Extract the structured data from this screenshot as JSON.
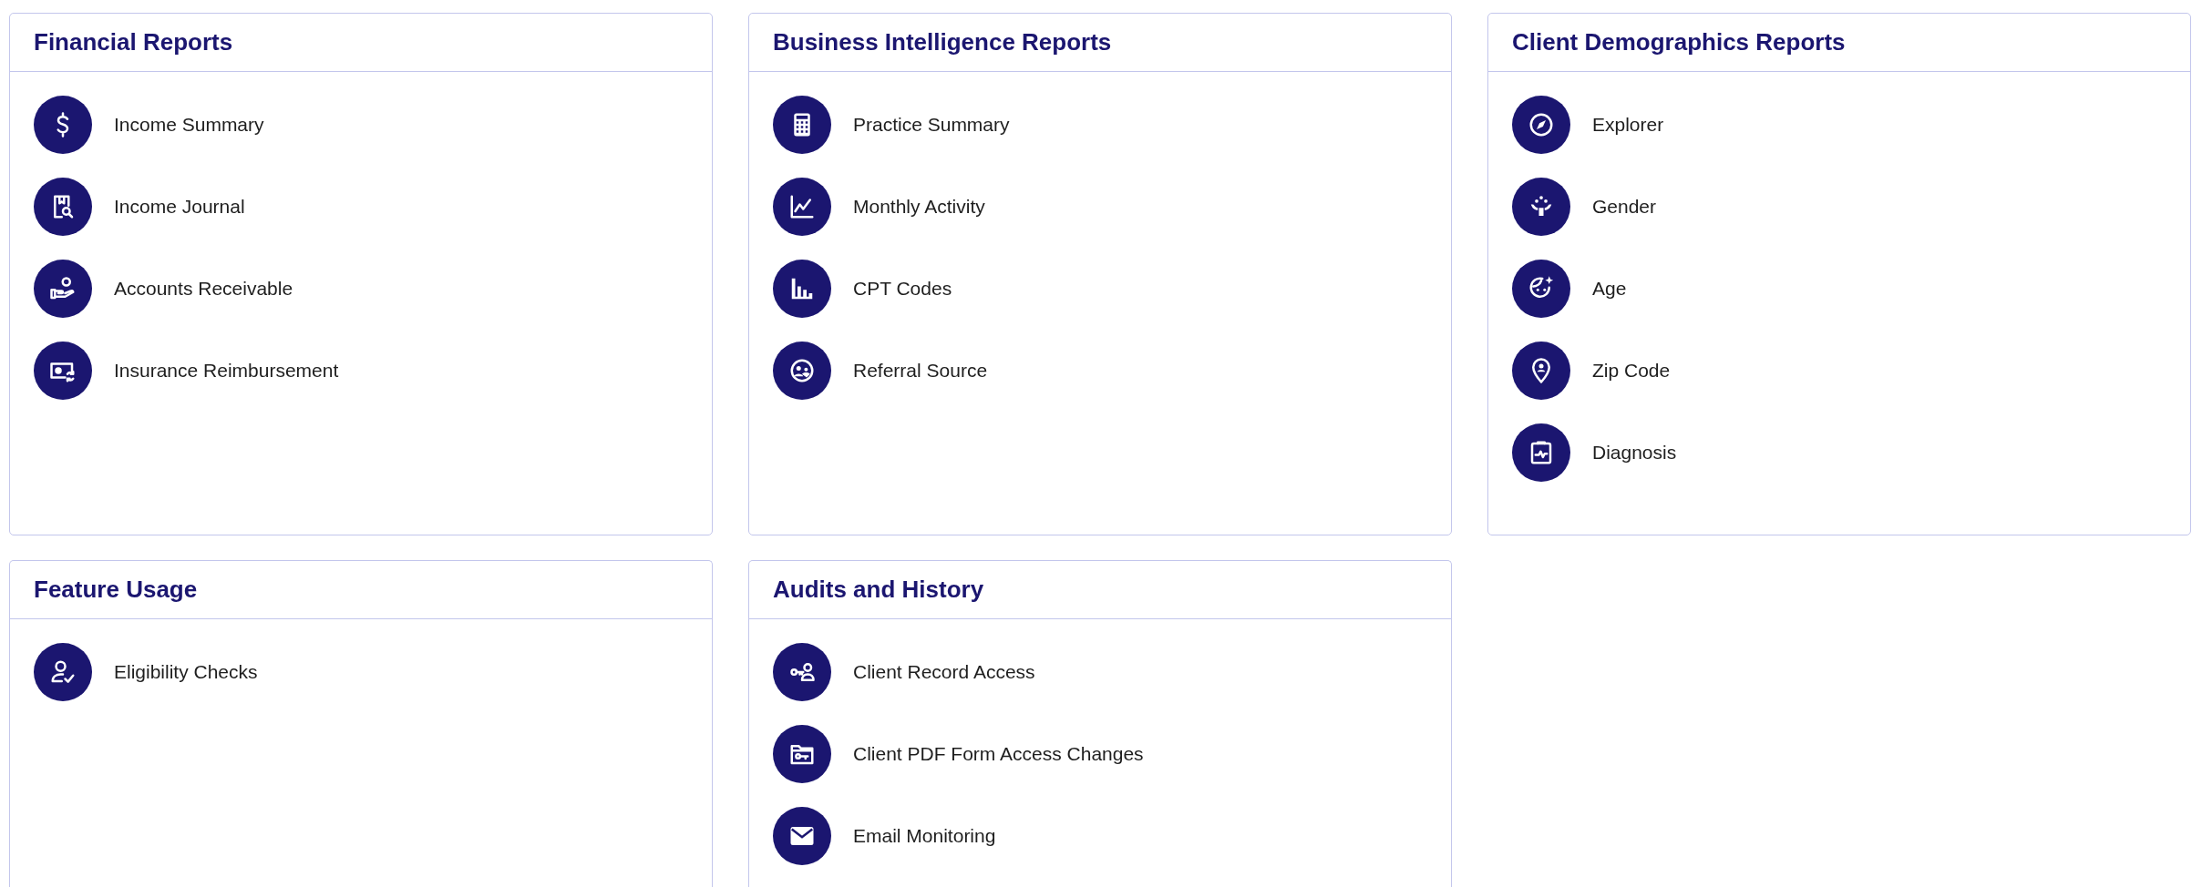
{
  "sections": [
    {
      "title": "Financial Reports",
      "items": [
        "Income Summary",
        "Income Journal",
        "Accounts Receivable",
        "Insurance Reimbursement"
      ]
    },
    {
      "title": "Business Intelligence Reports",
      "items": [
        "Practice Summary",
        "Monthly Activity",
        "CPT Codes",
        "Referral Source"
      ]
    },
    {
      "title": "Client Demographics Reports",
      "items": [
        "Explorer",
        "Gender",
        "Age",
        "Zip Code",
        "Diagnosis"
      ]
    },
    {
      "title": "Feature Usage",
      "items": [
        "Eligibility Checks"
      ]
    },
    {
      "title": "Audits and History",
      "items": [
        "Client Record Access",
        "Client PDF Form Access Changes",
        "Email Monitoring"
      ]
    }
  ]
}
